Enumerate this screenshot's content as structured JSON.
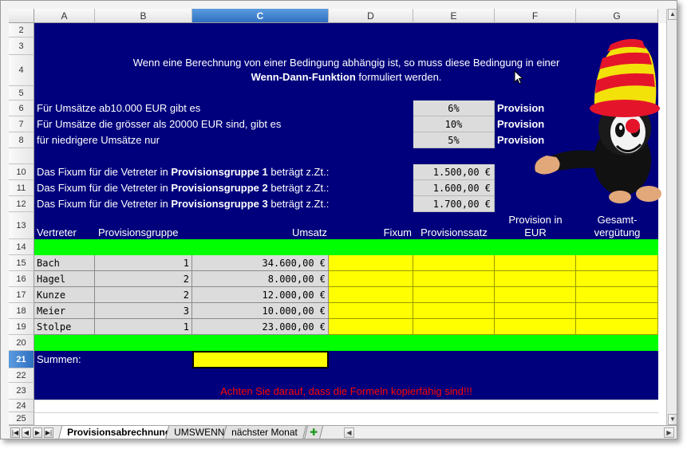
{
  "columns": [
    "A",
    "B",
    "C",
    "D",
    "E",
    "F",
    "G"
  ],
  "rows": [
    "2",
    "3",
    "4",
    "5",
    "6",
    "7",
    "8",
    "",
    "10",
    "11",
    "12",
    "13",
    "14",
    "15",
    "16",
    "17",
    "18",
    "19",
    "20",
    "21",
    "22",
    "23",
    "24",
    "25"
  ],
  "intro": {
    "line1": "Wenn eine Berechnung von einer Bedingung abhängig ist, so muss diese Bedingung in einer",
    "line2_bold": "Wenn-Dann-Funktion",
    "line2_rest": " formuliert werden."
  },
  "conditions": [
    {
      "text": "Für Umsätze ab10.000 EUR gibt es",
      "rate": "6%",
      "label": "Provision"
    },
    {
      "text": "Für Umsätze die grösser als 20000 EUR sind, gibt es",
      "rate": "10%",
      "label": "Provision"
    },
    {
      "text": "für niedrigere Umsätze nur",
      "rate": "5%",
      "label": "Provision"
    }
  ],
  "fixum": [
    {
      "pre": "Das Fixum für die Vetreter in ",
      "group": "Provisionsgruppe 1",
      "post": " beträgt z.Zt.:",
      "amount": "1.500,00 €"
    },
    {
      "pre": "Das Fixum für die Vetreter in ",
      "group": "Provisionsgruppe 2",
      "post": "  beträgt z.Zt.:",
      "amount": "1.600,00 €"
    },
    {
      "pre": "Das Fixum für die Vetreter in ",
      "group": "Provisionsgruppe 3",
      "post": "  beträgt z.Zt.:",
      "amount": "1.700,00 €"
    }
  ],
  "table": {
    "headers": {
      "vertreter": "Vertreter",
      "gruppe": "Provisionsgruppe",
      "umsatz": "Umsatz",
      "fixum": "Fixum",
      "satz": "Provisionssatz",
      "prov_eur_1": "Provision in",
      "prov_eur_2": "EUR",
      "gesamt_1": "Gesamt-",
      "gesamt_2": "vergütung"
    },
    "rows": [
      {
        "name": "Bach",
        "group": "1",
        "umsatz": "34.600,00 €"
      },
      {
        "name": "Hagel",
        "group": "2",
        "umsatz": "8.000,00 €"
      },
      {
        "name": "Kunze",
        "group": "2",
        "umsatz": "12.000,00 €"
      },
      {
        "name": "Meier",
        "group": "3",
        "umsatz": "10.000,00 €"
      },
      {
        "name": "Stolpe",
        "group": "1",
        "umsatz": "23.000,00 €"
      }
    ],
    "summen_label": "Summen:"
  },
  "warning": "Achten Sie darauf, dass die Formeln kopierfähig sind!!!",
  "tabs": [
    "Provisionsabrechnung",
    "UMSWENN",
    "nächster Monat"
  ],
  "colors": {
    "sheet_bg": "#00007c",
    "highlight": "#ffff00",
    "band": "#00ff00",
    "warning": "#ff0000"
  }
}
